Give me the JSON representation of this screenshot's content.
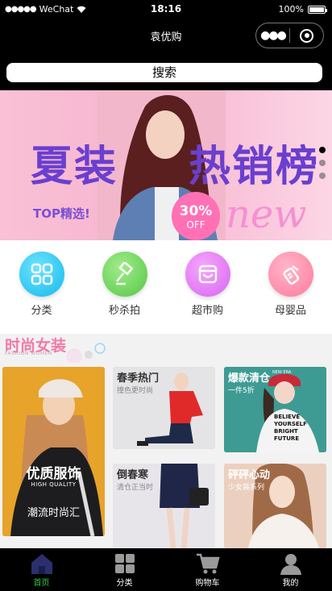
{
  "status_bar": {
    "carrier": "WeChat",
    "signal_dots": "●●●●●",
    "time": "18:16",
    "battery_percent": "100%",
    "battery_level": 1.0
  },
  "nav": {
    "title": "袁优购",
    "more_glyph": "●●●"
  },
  "search": {
    "placeholder": "搜索"
  },
  "banner": {
    "headline_left": "夏装",
    "headline_right": "热销榜",
    "sub": "TOP精选!",
    "percent": "30%",
    "off": "OFF",
    "script": "new",
    "slide_count": 3,
    "active_slide": 0
  },
  "categories": [
    {
      "label": "分类",
      "icon": "grid-icon",
      "color": "#1ec8f2"
    },
    {
      "label": "秒杀拍",
      "icon": "hammer-icon",
      "color": "#6dd45a"
    },
    {
      "label": "超市购",
      "icon": "shop-bag-icon",
      "color": "#e878f2"
    },
    {
      "label": "母婴品",
      "icon": "baby-bottle-icon",
      "color": "#ff7fa6"
    }
  ],
  "section": {
    "title": "时尚女装",
    "subtitle": "FASHION WOMEN",
    "big_card": {
      "caption": "优质服饰",
      "quality": "HIGH QUALITY",
      "tagline": "潮流时尚汇"
    },
    "cards": [
      {
        "title": "春季热门",
        "sub": "撞色更时尚"
      },
      {
        "title": "爆款清仓",
        "sub": "一件5折"
      },
      {
        "title": "倒春寒",
        "sub": "清仓正当时"
      },
      {
        "title": "砰砰心动",
        "sub": "少女装系列"
      }
    ],
    "shirt_text": [
      "BELIEVE",
      "YOURSELF",
      "BRIGHT",
      "FUTURE"
    ],
    "cap_text": "NEW ERA"
  },
  "tabbar": {
    "items": [
      {
        "label": "首页",
        "icon": "home-icon",
        "active": true
      },
      {
        "label": "分类",
        "icon": "category-grid-icon",
        "active": false
      },
      {
        "label": "购物车",
        "icon": "cart-icon",
        "active": false
      },
      {
        "label": "我的",
        "icon": "user-icon",
        "active": false
      }
    ]
  },
  "colors": {
    "accent_green": "#2ecc40",
    "section_title": "#f27aa6",
    "banner_purple": "#6a3fcf"
  }
}
